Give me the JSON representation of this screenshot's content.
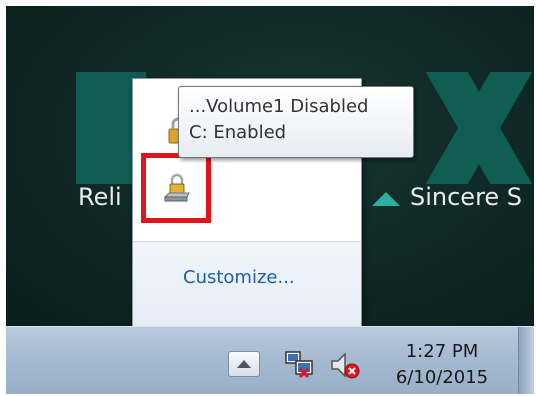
{
  "wallpaper": {
    "left_text": "Reli",
    "right_text": "Sincere S"
  },
  "tray_popup": {
    "customize_label": "Customize...",
    "icons": [
      "lock-icon",
      "bitlocker-drive-icon"
    ]
  },
  "tooltip": {
    "line1": "...Volume1 Disabled",
    "line2": "C: Enabled"
  },
  "taskbar": {
    "time": "1:27 PM",
    "date": "6/10/2015",
    "icons": [
      "chevron-up-icon",
      "network-icon",
      "volume-muted-icon"
    ]
  },
  "colors": {
    "highlight_box": "#e0141c",
    "link": "#1e5fa8",
    "brand_teal": "#0f5d53"
  }
}
